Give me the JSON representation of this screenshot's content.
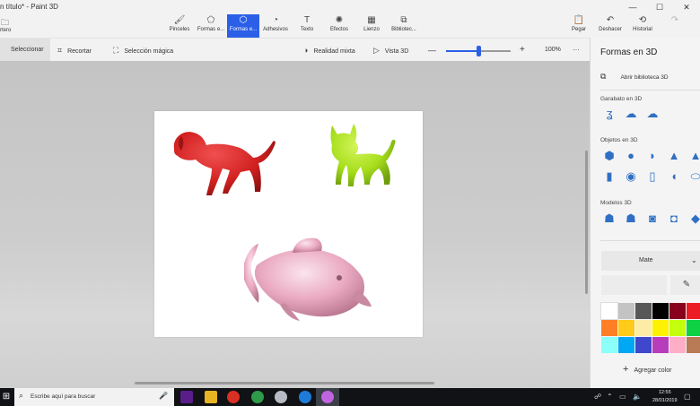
{
  "window": {
    "title": "n título* - Paint 3D",
    "controls": {
      "minimize": "—",
      "maximize": "☐",
      "close": "✕"
    }
  },
  "ribbon": {
    "menu_label": "rtero",
    "tools": [
      {
        "label": "Pinceles",
        "icon": "brush-icon"
      },
      {
        "label": "Formas e...",
        "icon": "2d-shapes-icon"
      },
      {
        "label": "Formas e...",
        "icon": "3d-shapes-icon",
        "active": true
      },
      {
        "label": "Adhesivos",
        "icon": "stickers-icon"
      },
      {
        "label": "Texto",
        "icon": "text-icon"
      },
      {
        "label": "Efectos",
        "icon": "effects-icon"
      },
      {
        "label": "Lienzo",
        "icon": "canvas-icon"
      },
      {
        "label": "Bibliotec...",
        "icon": "library-icon"
      }
    ],
    "actions": [
      {
        "label": "Pegar",
        "icon": "paste-icon"
      },
      {
        "label": "Deshacer",
        "icon": "undo-icon"
      },
      {
        "label": "Historial",
        "icon": "history-icon"
      }
    ]
  },
  "toolbar": {
    "select": "Seleccionar",
    "crop": "Recortar",
    "magic_select": "Selección mágica",
    "mixed_reality": "Realidad mixta",
    "view_3d": "Vista 3D",
    "zoom_out": "—",
    "zoom_in": "+",
    "zoom_level": 0.5,
    "zoom": "100%",
    "more": "···"
  },
  "panel": {
    "title": "Formas en 3D",
    "open_library": "Abrir biblioteca 3D",
    "doodle_label": "Garabato en 3D",
    "objects_label": "Objetos en 3D",
    "models_label": "Modelos 3D",
    "doodle_icons": [
      "sharp-doodle-icon",
      "soft-doodle-icon",
      "tube-doodle-icon"
    ],
    "object_icons": [
      "cube-icon",
      "sphere-icon",
      "hemisphere-icon",
      "cone-icon",
      "pyramid-icon",
      "cylinder-icon",
      "tube-icon",
      "capsule-icon",
      "donut-icon",
      "torus-icon"
    ],
    "model_icons": [
      "man-model-icon",
      "woman-model-icon",
      "dog-model-icon",
      "cat-model-icon",
      "fish-model-icon"
    ],
    "material": "Mate",
    "add_color": "Agregar color",
    "colors": [
      "#ffffff",
      "#c3c3c3",
      "#585858",
      "#000000",
      "#88001b",
      "#ec1c24",
      "#ff7f27",
      "#ffca18",
      "#fdeca6",
      "#fff200",
      "#c4ff0e",
      "#0ed145",
      "#8cfffb",
      "#00a8f3",
      "#3f48cc",
      "#b83dba",
      "#ffaec8",
      "#b97a56"
    ]
  },
  "canvas_objects": [
    {
      "name": "red-dog-model",
      "color": "#d92626"
    },
    {
      "name": "green-cat-model",
      "color": "#a6de1c"
    },
    {
      "name": "pink-fish-model",
      "color": "#e9a6be"
    }
  ],
  "taskbar": {
    "search_placeholder": "Escribe aquí para buscar",
    "time": "12:55",
    "date": "28/01/2019"
  }
}
